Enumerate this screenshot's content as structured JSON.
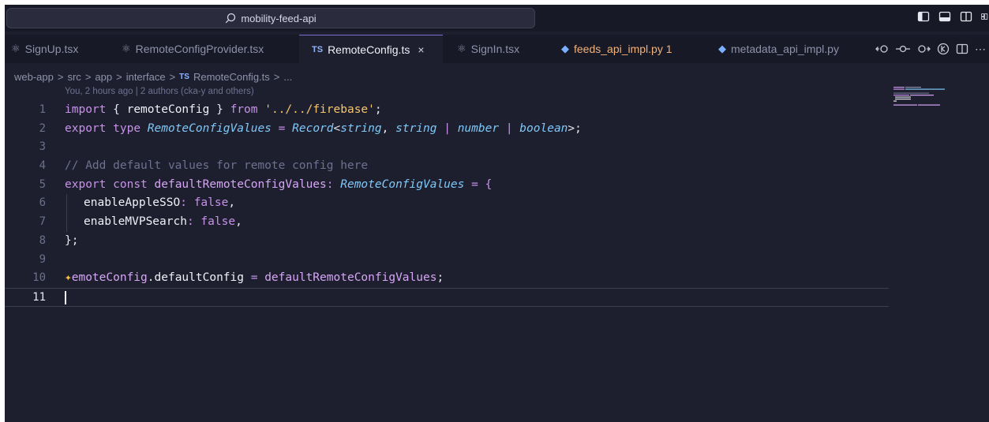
{
  "title_bar": {
    "search_text": "mobility-feed-api",
    "layout_icons": [
      "toggle-primary-sidebar-icon",
      "toggle-panel-icon",
      "toggle-secondary-sidebar-icon",
      "customize-layout-icon"
    ]
  },
  "tabs": [
    {
      "label": "SignUp.tsx",
      "icon": "react-icon"
    },
    {
      "label": "RemoteConfigProvider.tsx",
      "icon": "react-icon"
    },
    {
      "label": "RemoteConfig.ts",
      "icon": "typescript-icon",
      "badge": "TS",
      "active": true,
      "close": "×"
    },
    {
      "label": "SignIn.tsx",
      "icon": "react-icon"
    },
    {
      "label": "feeds_api_impl.py 1",
      "icon": "python-icon"
    },
    {
      "label": "metadata_api_impl.py",
      "icon": "python-icon"
    }
  ],
  "tab_actions": [
    "go-back-icon",
    "source-control-icon",
    "go-forward-icon",
    "timeline-icon",
    "split-editor-icon",
    "more-actions-icon"
  ],
  "breadcrumb": {
    "items": [
      "web-app",
      "src",
      "app",
      "interface"
    ],
    "file_badge": "TS",
    "file": "RemoteConfig.ts",
    "trailing": "...",
    "separator": ">"
  },
  "blame": "You, 2 hours ago | 2 authors (cka-y and others)",
  "editor": {
    "line_numbers": [
      "1",
      "2",
      "3",
      "4",
      "5",
      "6",
      "7",
      "8",
      "9",
      "10",
      "11"
    ],
    "current_line": "11",
    "code": {
      "l1": [
        "import",
        " { ",
        "remoteConfig",
        " } ",
        "from",
        " ",
        "'../../firebase'",
        ";"
      ],
      "l2": [
        "export",
        " ",
        "type",
        " ",
        "RemoteConfigValues",
        " = ",
        "Record",
        "<",
        "string",
        ", ",
        "string",
        " | ",
        "number",
        " | ",
        "boolean",
        ">;"
      ],
      "l4": "// Add default values for remote config here",
      "l5": [
        "export",
        " ",
        "const",
        " ",
        "defaultRemoteConfigValues",
        ": ",
        "RemoteConfigValues",
        " = {"
      ],
      "l6": [
        "enableAppleSSO",
        ": ",
        "false",
        ","
      ],
      "l7": [
        "enableMVPSearch",
        ": ",
        "false",
        ","
      ],
      "l8": "};",
      "l10": [
        "✦",
        "emoteConfig",
        ".",
        "defaultConfig",
        " = ",
        "defaultRemoteConfigValues",
        ";"
      ]
    }
  },
  "colors": {
    "editor_bg": "#1e1f2e",
    "titlebar_bg": "#181926",
    "keyword": "#c792ea",
    "string": "#f5c66d",
    "type": "#7fc8f8",
    "comment": "#6d7190",
    "accent": "#7f6bd6"
  }
}
